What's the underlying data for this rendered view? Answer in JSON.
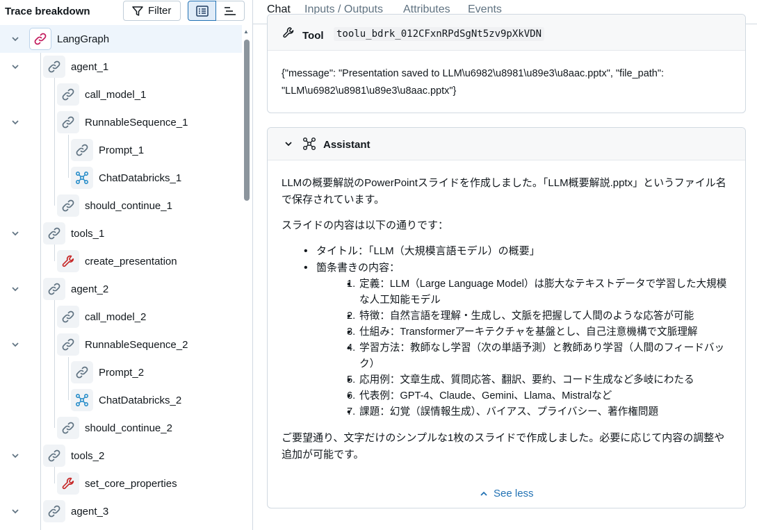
{
  "left_panel": {
    "title": "Trace breakdown",
    "filter_label": "Filter",
    "tree": [
      {
        "label": "LangGraph",
        "icon": "link-icon",
        "depth": 0,
        "expanded": true,
        "selected": true
      },
      {
        "label": "agent_1",
        "icon": "link-icon",
        "depth": 1,
        "expanded": true
      },
      {
        "label": "call_model_1",
        "icon": "link-icon",
        "depth": 2
      },
      {
        "label": "RunnableSequence_1",
        "icon": "link-icon",
        "depth": 2,
        "expanded": true
      },
      {
        "label": "Prompt_1",
        "icon": "link-icon",
        "depth": 3
      },
      {
        "label": "ChatDatabricks_1",
        "icon": "model-icon",
        "depth": 3
      },
      {
        "label": "should_continue_1",
        "icon": "link-icon",
        "depth": 2
      },
      {
        "label": "tools_1",
        "icon": "link-icon",
        "depth": 1,
        "expanded": true
      },
      {
        "label": "create_presentation",
        "icon": "wrench-icon",
        "depth": 2
      },
      {
        "label": "agent_2",
        "icon": "link-icon",
        "depth": 1,
        "expanded": true
      },
      {
        "label": "call_model_2",
        "icon": "link-icon",
        "depth": 2
      },
      {
        "label": "RunnableSequence_2",
        "icon": "link-icon",
        "depth": 2,
        "expanded": true
      },
      {
        "label": "Prompt_2",
        "icon": "link-icon",
        "depth": 3
      },
      {
        "label": "ChatDatabricks_2",
        "icon": "model-icon",
        "depth": 3
      },
      {
        "label": "should_continue_2",
        "icon": "link-icon",
        "depth": 2
      },
      {
        "label": "tools_2",
        "icon": "link-icon",
        "depth": 1,
        "expanded": true
      },
      {
        "label": "set_core_properties",
        "icon": "wrench-icon",
        "depth": 2
      },
      {
        "label": "agent_3",
        "icon": "link-icon",
        "depth": 1,
        "expanded": true
      }
    ]
  },
  "tabs": [
    "Chat",
    "Inputs / Outputs",
    "Attributes",
    "Events"
  ],
  "active_tab": "Chat",
  "tool_message": {
    "role": "Tool",
    "id": "toolu_bdrk_012CFxnRPdSgNt5zv9pXkVDN",
    "content": "{\"message\": \"Presentation saved to LLM\\u6982\\u8981\\u89e3\\u8aac.pptx\", \"file_path\": \"LLM\\u6982\\u8981\\u89e3\\u8aac.pptx\"}"
  },
  "assistant_message": {
    "role": "Assistant",
    "intro": "LLMの概要解説のPowerPointスライドを作成しました。「LLM概要解説.pptx」というファイル名で保存されています。",
    "contents_heading": "スライドの内容は以下の通りです：",
    "bullets": [
      "タイトル：「LLM（大規模言語モデル）の概要」",
      "箇条書きの内容："
    ],
    "numbered": [
      "定義：LLM（Large Language Model）は膨大なテキストデータで学習した大規模な人工知能モデル",
      "特徴：自然言語を理解・生成し、文脈を把握して人間のような応答が可能",
      "仕組み：Transformerアーキテクチャを基盤とし、自己注意機構で文脈理解",
      "学習方法：教師なし学習（次の単語予測）と教師あり学習（人間のフィードバック）",
      "応用例：文章生成、質問応答、翻訳、要約、コード生成など多岐にわたる",
      "代表例：GPT-4、Claude、Gemini、Llama、Mistralなど",
      "課題：幻覚（誤情報生成）、バイアス、プライバシー、著作権問題"
    ],
    "closing": "ご要望通り、文字だけのシンプルな1枚のスライドで作成しました。必要に応じて内容の調整や追加が可能です。",
    "see_less_label": "See less"
  },
  "colors": {
    "accent": "#2272b4",
    "link_icon_root": "#c2185b",
    "wrench_icon": "#c62828",
    "model_icon": "#1e88c7"
  }
}
